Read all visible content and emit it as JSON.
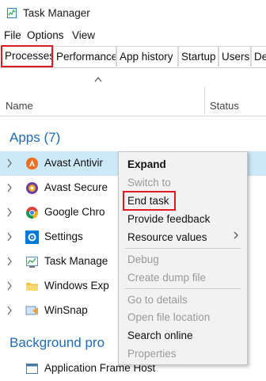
{
  "window": {
    "title": "Task Manager"
  },
  "menu": [
    "File",
    "Options",
    "View"
  ],
  "tabs": [
    "Processes",
    "Performance",
    "App history",
    "Startup",
    "Users",
    "De"
  ],
  "columns": {
    "name": "Name",
    "status": "Status"
  },
  "apps": {
    "header": "Apps (7)",
    "items": [
      {
        "label": "Avast Antivir",
        "icon": "avast-icon"
      },
      {
        "label": "Avast Secure",
        "icon": "avast-secure-browser-icon"
      },
      {
        "label": "Google Chro",
        "icon": "chrome-icon"
      },
      {
        "label": "Settings",
        "icon": "settings-icon"
      },
      {
        "label": "Task Manage",
        "icon": "task-manager-icon"
      },
      {
        "label": "Windows Exp",
        "icon": "windows-explorer-icon"
      },
      {
        "label": "WinSnap",
        "icon": "winsnap-icon"
      }
    ]
  },
  "background": {
    "header": "Background pro",
    "items": [
      {
        "label": "Application Frame Host",
        "icon": "app-frame-host-icon"
      }
    ]
  },
  "context_menu": {
    "expand": "Expand",
    "switch_to": "Switch to",
    "end_task": "End task",
    "provide_feedback": "Provide feedback",
    "resource_values": "Resource values",
    "debug": "Debug",
    "create_dump": "Create dump file",
    "go_to_details": "Go to details",
    "open_file_location": "Open file location",
    "search_online": "Search online",
    "properties": "Properties"
  },
  "colors": {
    "accent_blue": "#1e6bb8",
    "highlight_red": "#e11b22",
    "selection": "#cde8f6"
  }
}
